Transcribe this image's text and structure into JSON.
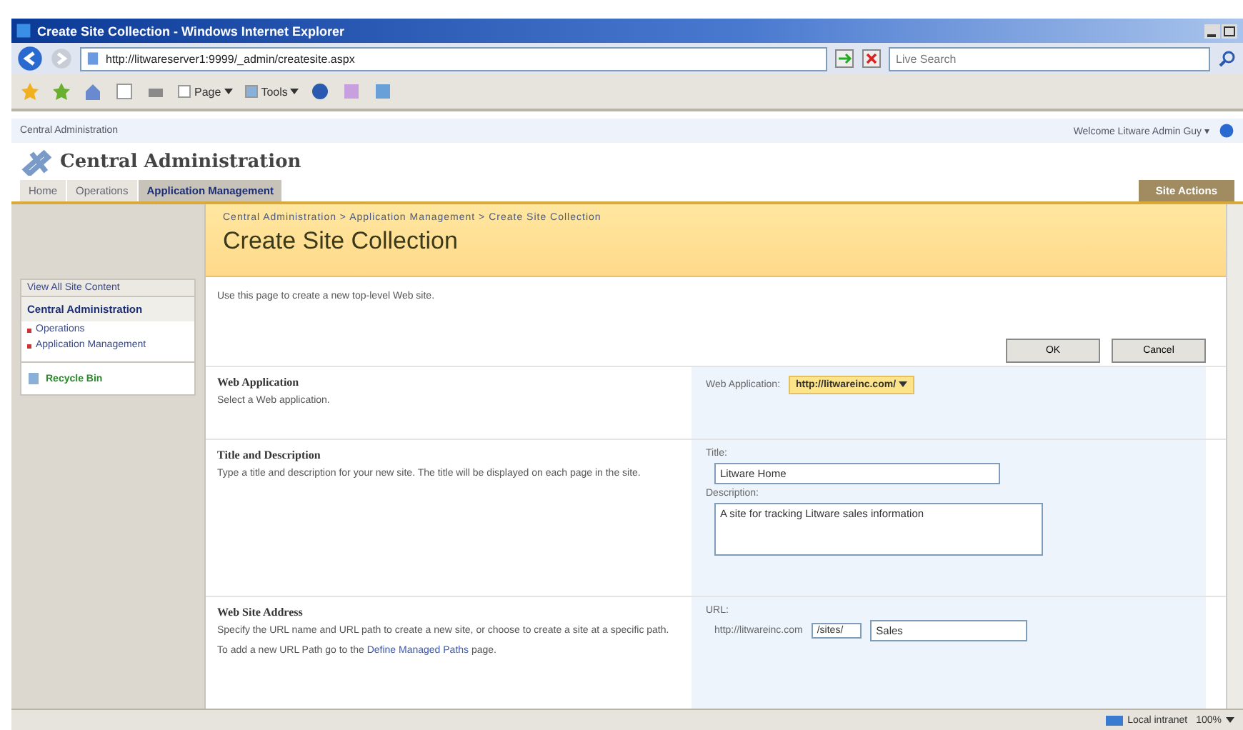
{
  "window": {
    "title": "Create Site Collection - Windows Internet Explorer"
  },
  "address_bar": {
    "url": "http://litwareserver1:9999/_admin/createsite.aspx"
  },
  "search": {
    "placeholder": "Live Search"
  },
  "command_bar": [
    {
      "label": "Page"
    },
    {
      "label": "Tools"
    }
  ],
  "site_bar": {
    "breadcrumb": "Central Administration",
    "welcome": "Welcome Litware Admin Guy ▾"
  },
  "site_title": "Central Administration",
  "tabs": [
    {
      "label": "Home",
      "selected": false
    },
    {
      "label": "Operations",
      "selected": false
    },
    {
      "label": "Application Management",
      "selected": true
    }
  ],
  "site_actions": "Site Actions",
  "breadcrumb": {
    "items": [
      "Central Administration",
      "Application Management",
      "Create Site Collection"
    ],
    "separator": ">"
  },
  "page_title": "Create Site Collection",
  "quick_launch": {
    "view_all": "View All Site Content",
    "heading": "Central Administration",
    "items": [
      "Operations",
      "Application Management"
    ],
    "recycle_bin": "Recycle Bin"
  },
  "intro": "Use this page to create a new top-level Web site.",
  "buttons": [
    "OK",
    "Cancel"
  ],
  "sections": [
    {
      "kind": "select",
      "title": "Web Application",
      "paragraphs": [
        {
          "text": "Select a Web application."
        }
      ],
      "label": "Web Application:",
      "value": "http://litwareinc.com/"
    },
    {
      "kind": "title_description",
      "title": "Title and Description",
      "paragraphs": [
        {
          "text": "Type a title and description for your new site. The title will be displayed on each page in the site."
        }
      ],
      "title_label": "Title:",
      "title_value": "Litware Home",
      "description_label": "Description:",
      "description_value": "A site for tracking Litware sales information"
    },
    {
      "kind": "url",
      "title": "Web Site Address",
      "paragraphs": [
        {
          "text": "Specify the URL name and URL path to create a new site, or choose to create a site at a specific path."
        },
        {
          "text": "To add a new URL Path go to the ",
          "link": "Define Managed Paths",
          "after": " page."
        }
      ],
      "label": "URL:",
      "prefix": "http://litwareinc.com",
      "path": "/sites/",
      "value": "Sales"
    }
  ],
  "status_bar": {
    "zone": "Local intranet",
    "zoom": "100%"
  }
}
